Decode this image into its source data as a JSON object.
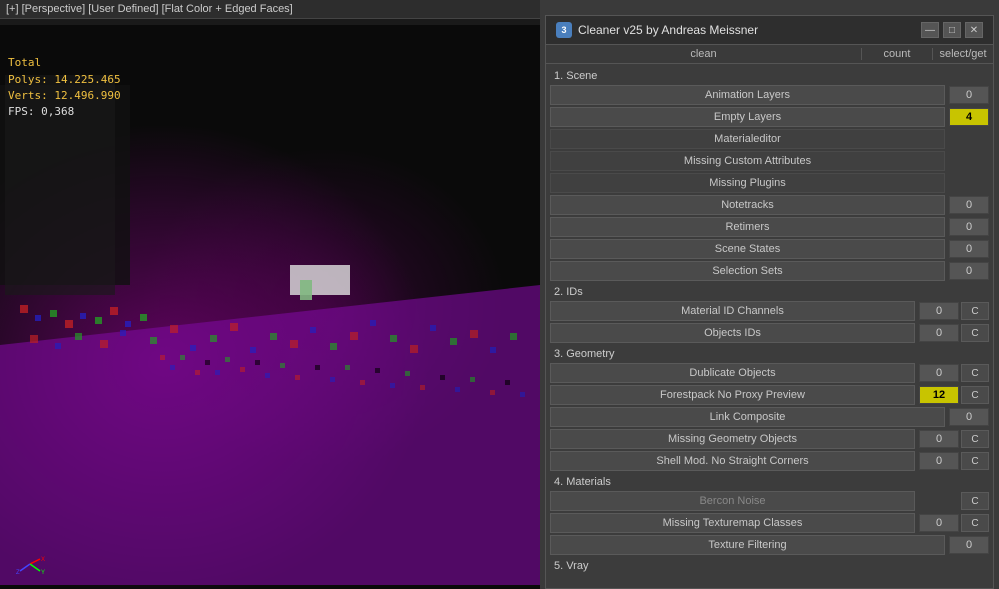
{
  "viewport": {
    "header": "[+] [Perspective] [User Defined] [Flat Color + Edged Faces]",
    "stats": {
      "total_label": "Total",
      "polys_label": "Polys:",
      "polys_value": "14.225.465",
      "verts_label": "Verts:",
      "verts_value": "12.496.990"
    },
    "fps_label": "FPS:",
    "fps_value": "0,368"
  },
  "dialog": {
    "title": "Cleaner v25 by Andreas Meissner",
    "icon_label": "3",
    "controls": {
      "minimize": "—",
      "restore": "□",
      "close": "✕"
    }
  },
  "columns": {
    "clean": "clean",
    "divider": "|",
    "count": "count",
    "divider2": "|",
    "select_get": "select/get"
  },
  "sections": [
    {
      "id": "scene",
      "label": "1. Scene",
      "rows": [
        {
          "id": "animation-layers",
          "label": "Animation Layers",
          "count": "0",
          "highlighted": false,
          "has_select": false
        },
        {
          "id": "empty-layers",
          "label": "Empty Layers",
          "count": "4",
          "highlighted": true,
          "has_select": false
        },
        {
          "id": "materialeditor",
          "label": "Materialeditor",
          "count": null,
          "highlighted": false,
          "has_select": false,
          "no_count": true
        },
        {
          "id": "missing-custom-attributes",
          "label": "Missing Custom Attributes",
          "count": null,
          "highlighted": false,
          "has_select": false,
          "no_count": true
        },
        {
          "id": "missing-plugins",
          "label": "Missing Plugins",
          "count": null,
          "highlighted": false,
          "has_select": false,
          "no_count": true
        },
        {
          "id": "notetracks",
          "label": "Notetracks",
          "count": "0",
          "highlighted": false,
          "has_select": false
        },
        {
          "id": "retimers",
          "label": "Retimers",
          "count": "0",
          "highlighted": false,
          "has_select": false
        },
        {
          "id": "scene-states",
          "label": "Scene States",
          "count": "0",
          "highlighted": false,
          "has_select": false
        },
        {
          "id": "selection-sets",
          "label": "Selection Sets",
          "count": "0",
          "highlighted": false,
          "has_select": false
        }
      ]
    },
    {
      "id": "ids",
      "label": "2. IDs",
      "rows": [
        {
          "id": "material-id-channels",
          "label": "Material ID Channels",
          "count": "0",
          "highlighted": false,
          "has_select": true
        },
        {
          "id": "objects-ids",
          "label": "Objects IDs",
          "count": "0",
          "highlighted": false,
          "has_select": true
        }
      ]
    },
    {
      "id": "geometry",
      "label": "3. Geometry",
      "rows": [
        {
          "id": "duplicate-objects",
          "label": "Dublicate Objects",
          "count": "0",
          "highlighted": false,
          "has_select": true
        },
        {
          "id": "forestpack-no-proxy",
          "label": "Forestpack No Proxy Preview",
          "count": "12",
          "highlighted": true,
          "has_select": true
        },
        {
          "id": "link-composite",
          "label": "Link Composite",
          "count": "0",
          "highlighted": false,
          "has_select": false
        },
        {
          "id": "missing-geometry-objects",
          "label": "Missing Geometry Objects",
          "count": "0",
          "highlighted": false,
          "has_select": true
        },
        {
          "id": "shell-mod",
          "label": "Shell Mod. No Straight Corners",
          "count": "0",
          "highlighted": false,
          "has_select": true
        }
      ]
    },
    {
      "id": "materials",
      "label": "4. Materials",
      "rows": [
        {
          "id": "bercon-noise",
          "label": "Bercon Noise",
          "count": null,
          "highlighted": false,
          "has_select": true,
          "no_count": true,
          "disabled": true
        },
        {
          "id": "missing-texturemap",
          "label": "Missing Texturemap Classes",
          "count": "0",
          "highlighted": false,
          "has_select": true
        },
        {
          "id": "texture-filtering",
          "label": "Texture Filtering",
          "count": "0",
          "highlighted": false,
          "has_select": false
        }
      ]
    },
    {
      "id": "vray",
      "label": "5. Vray",
      "rows": []
    }
  ]
}
